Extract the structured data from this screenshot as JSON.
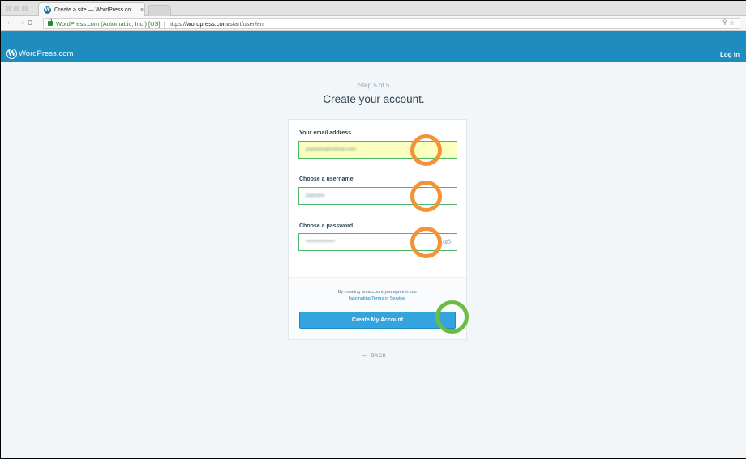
{
  "browser": {
    "tab_title": "Create a site — WordPress.co",
    "tab_close": "×",
    "address": {
      "identity": "WordPress.com (Automattic, Inc.) [US]",
      "protocol": "https://",
      "host": "wordpress.com",
      "path": "/start/user/en"
    },
    "nav": {
      "back": "←",
      "forward": "→",
      "reload": "C"
    },
    "toolbar_right": "Ÿ ☆"
  },
  "masterbar": {
    "logo_mark": "W",
    "brand": "WordPress.com",
    "login": "Log In"
  },
  "signup": {
    "step": "Step 5 of 5",
    "heading": "Create your account.",
    "email": {
      "label": "Your email address",
      "value": "paperjoe@hotmail.com"
    },
    "username": {
      "label": "Choose a username",
      "value": "paperjoe"
    },
    "password": {
      "label": "Choose a password",
      "value": "•••••••••••••••••"
    },
    "tos_text": "By creating an account you agree to our",
    "tos_link": "fascinating Terms of Service.",
    "submit": "Create My Account",
    "back": "BACK",
    "back_arrow": "←"
  },
  "colors": {
    "masterbar": "#1e8cbe",
    "cta": "#33a4dd",
    "valid_border": "#4ab866",
    "autofill": "#faffbd",
    "annotation_field": "#f39237",
    "annotation_button": "#6dbb45"
  }
}
